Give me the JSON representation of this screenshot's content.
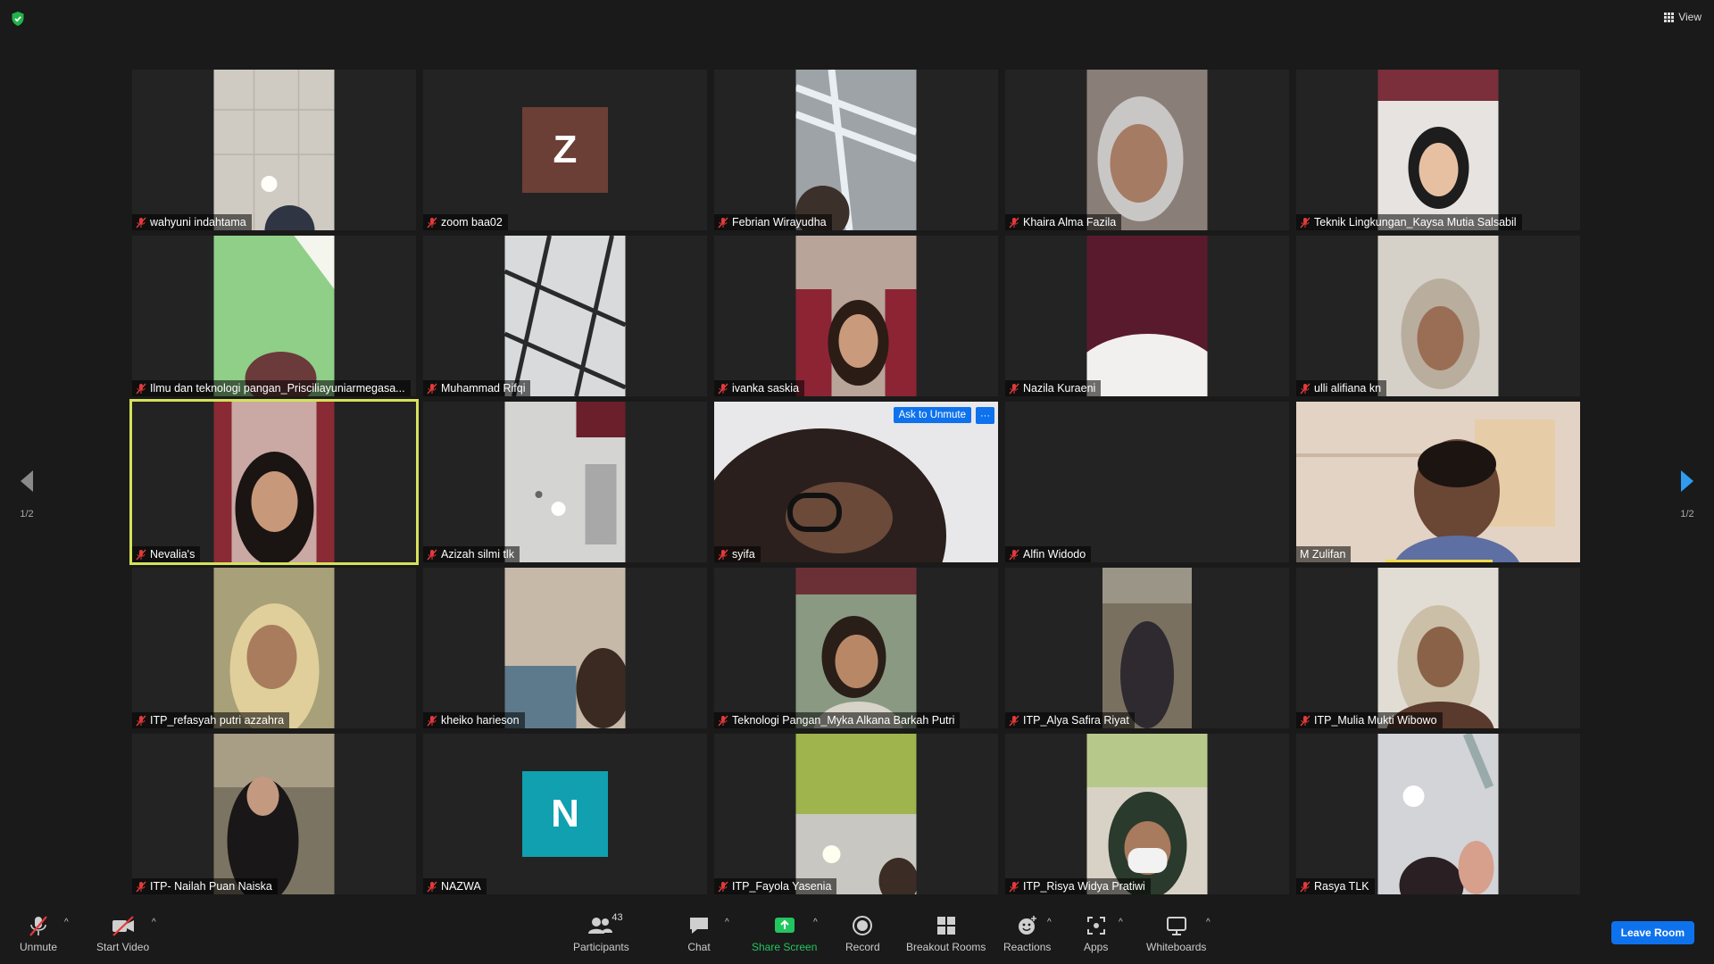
{
  "header": {
    "view_label": "View"
  },
  "colors": {
    "accent": "#0e72ed",
    "active_border": "#d6e15a",
    "muted_red": "#e23a3a",
    "share_green": "#22c55e"
  },
  "pagination": {
    "left": "1/2",
    "right": "1/2"
  },
  "tile_actions": {
    "ask_to_unmute": "Ask to Unmute",
    "more": "···"
  },
  "participants_grid": [
    {
      "name": "wahyuni indahtama",
      "muted": true
    },
    {
      "name": "zoom baa02",
      "muted": true,
      "avatar_letter": "Z",
      "avatar_color": "#6b3f35"
    },
    {
      "name": "Febrian Wirayudha",
      "muted": true
    },
    {
      "name": "Khaira Alma Fazila",
      "muted": true
    },
    {
      "name": "Teknik Lingkungan_Kaysa Mutia Salsabil",
      "muted": true
    },
    {
      "name": "Ilmu dan teknologi pangan_Prisciliayuniarmegasa...",
      "muted": true
    },
    {
      "name": "Muhammad Rifqi",
      "muted": true
    },
    {
      "name": "ivanka saskia",
      "muted": true
    },
    {
      "name": "Nazila Kuraeni",
      "muted": true
    },
    {
      "name": "ulli alifiana kn",
      "muted": true
    },
    {
      "name": "Nevalia's",
      "muted": true
    },
    {
      "name": "Azizah silmi tlk",
      "muted": true
    },
    {
      "name": "syifa",
      "muted": true
    },
    {
      "name": "Alfin Widodo",
      "muted": true
    },
    {
      "name": "M Zulifan",
      "muted": false
    },
    {
      "name": "ITP_refasyah putri azzahra",
      "muted": true
    },
    {
      "name": "kheiko harieson",
      "muted": true
    },
    {
      "name": "Teknologi Pangan_Myka Alkana Barkah Putri",
      "muted": true
    },
    {
      "name": "ITP_Alya Safira Riyat",
      "muted": true
    },
    {
      "name": "ITP_Mulia Mukti Wibowo",
      "muted": true
    },
    {
      "name": "ITP- Nailah Puan Naiska",
      "muted": true
    },
    {
      "name": "NAZWA",
      "muted": true,
      "avatar_letter": "N",
      "avatar_color": "#10a0b0"
    },
    {
      "name": "ITP_Fayola Yasenia",
      "muted": true
    },
    {
      "name": "ITP_Risya Widya Pratiwi",
      "muted": true
    },
    {
      "name": "Rasya TLK",
      "muted": true
    }
  ],
  "toolbar": {
    "unmute": "Unmute",
    "start_video": "Start Video",
    "participants": "Participants",
    "participants_count": "43",
    "chat": "Chat",
    "share_screen": "Share Screen",
    "record": "Record",
    "breakout_rooms": "Breakout Rooms",
    "reactions": "Reactions",
    "apps": "Apps",
    "whiteboards": "Whiteboards",
    "leave": "Leave Room"
  }
}
